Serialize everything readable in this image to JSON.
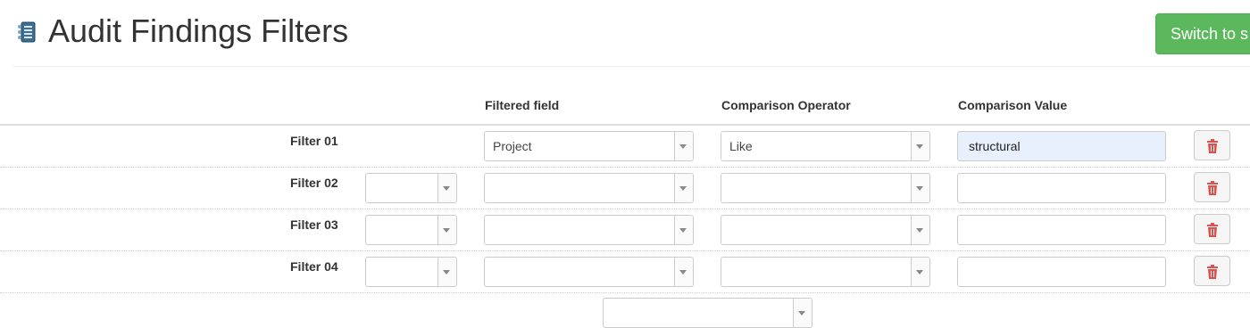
{
  "header": {
    "title": "Audit Findings Filters",
    "switch_button_label": "Switch to s",
    "icon": "filter-list-icon"
  },
  "columns": {
    "filtered_field": "Filtered field",
    "comparison_operator": "Comparison Operator",
    "comparison_value": "Comparison Value"
  },
  "filters": [
    {
      "label": "Filter 01",
      "connector": "",
      "field": "Project",
      "operator": "Like",
      "value": "structural"
    },
    {
      "label": "Filter 02",
      "connector": "",
      "field": "",
      "operator": "",
      "value": ""
    },
    {
      "label": "Filter 03",
      "connector": "",
      "field": "",
      "operator": "",
      "value": ""
    },
    {
      "label": "Filter 04",
      "connector": "",
      "field": "",
      "operator": "",
      "value": ""
    }
  ],
  "footer": {
    "select_value": ""
  },
  "icons": {
    "delete": "trash-icon",
    "dropdown": "chevron-down-icon"
  },
  "colors": {
    "accent_green": "#5cb85c",
    "delete_red": "#d9534f",
    "highlight_yellow": "#f3f300",
    "filled_input_bg": "#e8f0fe"
  }
}
